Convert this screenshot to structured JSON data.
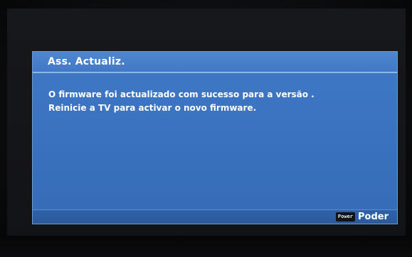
{
  "dialog": {
    "title": "Ass. Actualiz.",
    "message_line_1": "O firmware foi actualizado com sucesso para a versão .",
    "message_line_2": "Reinicie a TV para activar o novo firmware."
  },
  "footer": {
    "power_key_label": "Power",
    "power_action_label": "Poder"
  },
  "colors": {
    "dialog_background": "#3a72bf",
    "title_bar": "#4279c4",
    "footer_bar": "#2b5a9d",
    "text": "#ffffff"
  }
}
